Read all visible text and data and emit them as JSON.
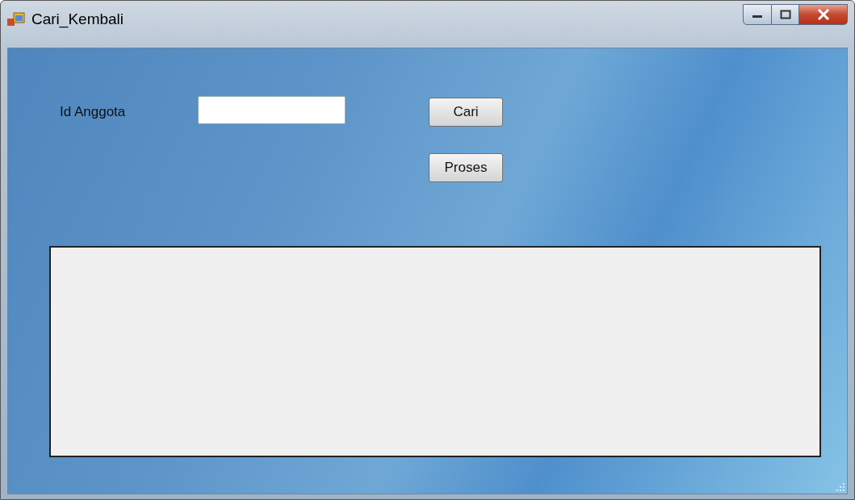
{
  "window": {
    "title": "Cari_Kembali"
  },
  "form": {
    "label": "Id Anggota"
  },
  "buttons": [
    "Cari",
    "Proses"
  ]
}
